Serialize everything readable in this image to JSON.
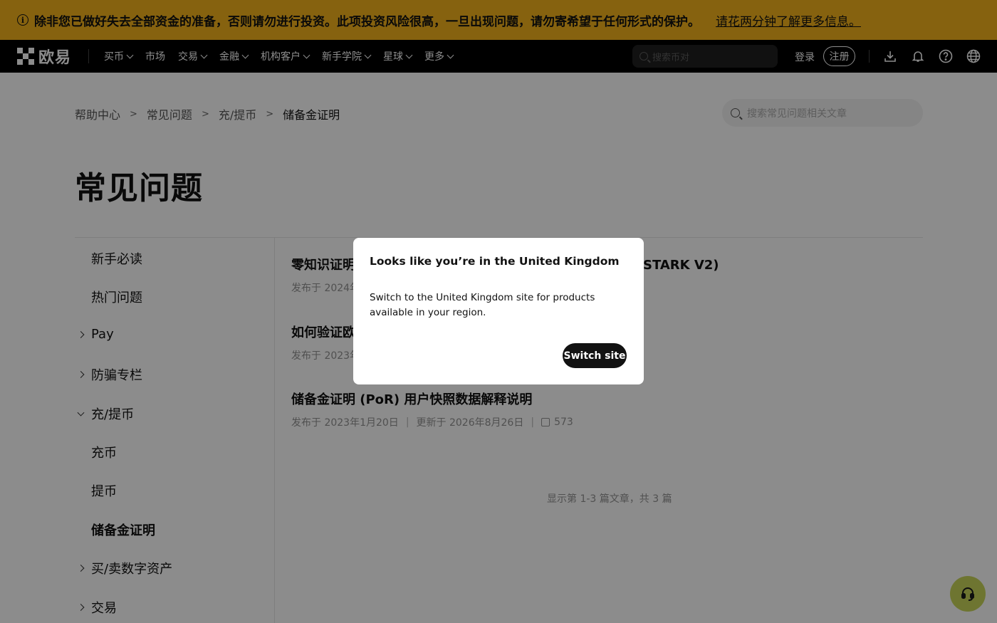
{
  "banner": {
    "icon": "info-icon",
    "text": "除非您已做好失去全部资金的准备，否则请勿进行投资。此项投资风险很高，一旦出现问题，请勿寄希望于任何形式的保护。",
    "link": "请花两分钟了解更多信息。"
  },
  "nav": {
    "logo_text": "欧易",
    "items": [
      {
        "label": "买币",
        "dropdown": true
      },
      {
        "label": "市场",
        "dropdown": false
      },
      {
        "label": "交易",
        "dropdown": true
      },
      {
        "label": "金融",
        "dropdown": true
      },
      {
        "label": "机构客户",
        "dropdown": true
      },
      {
        "label": "新手学院",
        "dropdown": true
      },
      {
        "label": "星球",
        "dropdown": true
      },
      {
        "label": "更多",
        "dropdown": true
      }
    ],
    "search_placeholder": "搜索币对",
    "login": "登录",
    "register": "注册",
    "icons": [
      "download-icon",
      "bell-icon",
      "help-icon",
      "globe-icon"
    ]
  },
  "breadcrumb": [
    "帮助中心",
    "常见问题",
    "充/提币",
    "储备金证明"
  ],
  "help_search_placeholder": "搜索常见问题相关文章",
  "page_title": "常见问题",
  "sidebar": [
    {
      "label": "新手必读",
      "arrow": "none",
      "active": false
    },
    {
      "label": "热门问题",
      "arrow": "none",
      "active": false
    },
    {
      "label": "Pay",
      "arrow": "right",
      "active": false
    },
    {
      "label": "防骗专栏",
      "arrow": "right",
      "active": false
    },
    {
      "label": "充/提币",
      "arrow": "down",
      "active": false
    },
    {
      "label": "充币",
      "arrow": "none",
      "active": false
    },
    {
      "label": "提币",
      "arrow": "none",
      "active": false
    },
    {
      "label": "储备金证明",
      "arrow": "none",
      "active": true
    },
    {
      "label": "买/卖数字资产",
      "arrow": "right",
      "active": false
    },
    {
      "label": "交易",
      "arrow": "right",
      "active": false
    }
  ],
  "articles": [
    {
      "title_left": "零知识证明",
      "title_right": "STARK V2)",
      "date": "发布于 2024年"
    },
    {
      "title_left": "如何验证欧",
      "date": "发布于 2023年"
    },
    {
      "title": "储备金证明 (PoR) 用户快照数据解释说明",
      "date": "发布于 2023年1月20日",
      "updated": "更新于 2026年8月26日",
      "likes": "573"
    }
  ],
  "pagination": "显示第 1-3 篇文章，共 3 篇",
  "modal": {
    "title": "Looks like you’re in the United Kingdom",
    "body": "Switch to the United Kingdom site for products available in your region.",
    "button": "Switch site"
  },
  "support_icon": "headset-icon"
}
